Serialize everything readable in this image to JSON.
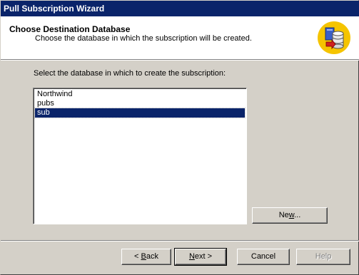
{
  "window": {
    "title": "Pull Subscription Wizard"
  },
  "header": {
    "title": "Choose Destination Database",
    "subtitle": "Choose the database in which the subscription will be created.",
    "icon": "database-wizard-icon"
  },
  "main": {
    "prompt": "Select the database in which to create the subscription:",
    "databases": [
      {
        "label": "Northwind",
        "selected": false
      },
      {
        "label": "pubs",
        "selected": false
      },
      {
        "label": "sub",
        "selected": true
      }
    ],
    "new_button": {
      "label": "New...",
      "mnemonic": "w"
    }
  },
  "footer": {
    "back_label": "< Back",
    "next_label": "Next >",
    "cancel_label": "Cancel",
    "help_label": "Help"
  },
  "colors": {
    "titlebar": "#0a246a",
    "face": "#d4d0c8",
    "selection": "#0a246a",
    "icon_circle": "#f5c400"
  }
}
